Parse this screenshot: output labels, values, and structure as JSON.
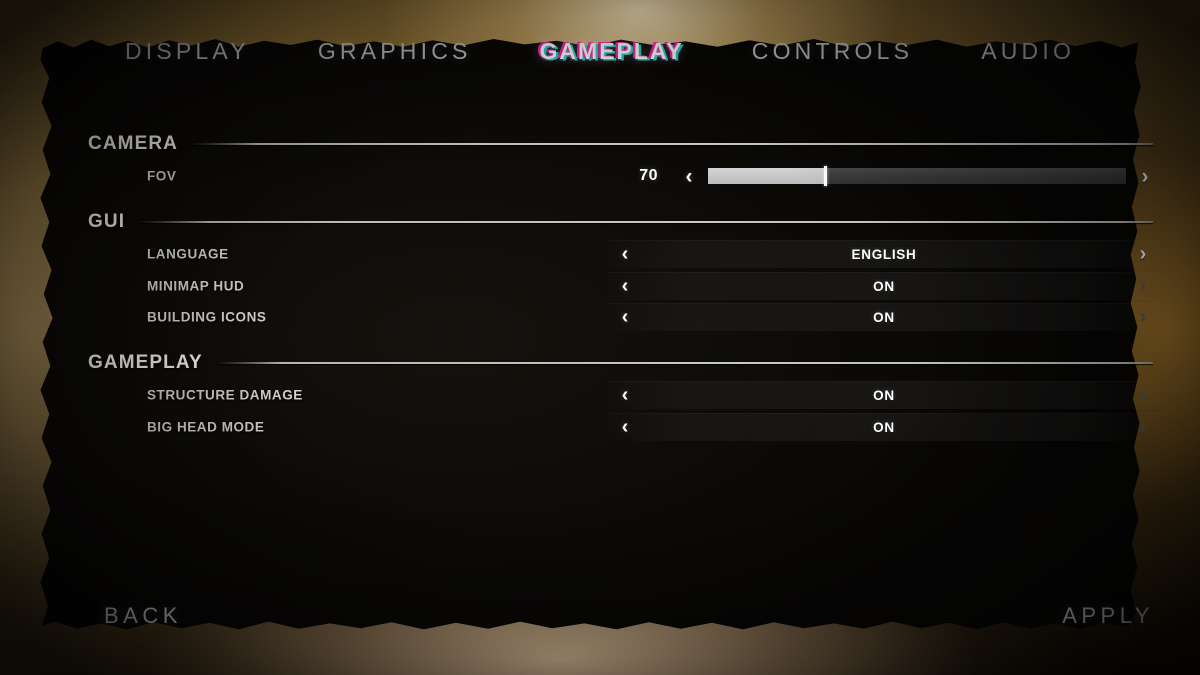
{
  "menu": {
    "tabs": [
      {
        "label": "DISPLAY",
        "active": false
      },
      {
        "label": "GRAPHICS",
        "active": false
      },
      {
        "label": "GAMEPLAY",
        "active": true
      },
      {
        "label": "CONTROLS",
        "active": false
      },
      {
        "label": "AUDIO",
        "active": false
      }
    ],
    "sections": [
      {
        "title": "CAMERA",
        "options": [
          {
            "label": "FOV",
            "type": "slider",
            "value": "70",
            "fill_percent": 28,
            "left_arrow": "‹",
            "right_arrow": "›",
            "left_enabled": true,
            "right_enabled": true
          }
        ]
      },
      {
        "title": "GUI",
        "options": [
          {
            "label": "LANGUAGE",
            "type": "selector",
            "value": "ENGLISH",
            "left_arrow": "‹",
            "right_arrow": "›",
            "left_enabled": true,
            "right_enabled": true
          },
          {
            "label": "MINIMAP HUD",
            "type": "selector",
            "value": "ON",
            "left_arrow": "‹",
            "right_arrow": "›",
            "left_enabled": true,
            "right_enabled": false
          },
          {
            "label": "BUILDING ICONS",
            "type": "selector",
            "value": "ON",
            "left_arrow": "‹",
            "right_arrow": "›",
            "left_enabled": true,
            "right_enabled": false
          }
        ]
      },
      {
        "title": "GAMEPLAY",
        "options": [
          {
            "label": "STRUCTURE DAMAGE",
            "type": "selector",
            "value": "ON",
            "left_arrow": "‹",
            "right_arrow": "›",
            "left_enabled": true,
            "right_enabled": false
          },
          {
            "label": "BIG HEAD MODE",
            "type": "selector",
            "value": "ON",
            "left_arrow": "‹",
            "right_arrow": "›",
            "left_enabled": true,
            "right_enabled": false
          }
        ]
      }
    ],
    "footer": {
      "back_label": "BACK",
      "apply_label": "APPLY"
    },
    "colors": {
      "panel": "#0b0907",
      "backdrop_warm": "#8a6c33",
      "text_primary": "#ffffff",
      "text_label": "#d6d3cd",
      "text_muted": "#5a5a58",
      "rule": "#d4d4cf",
      "slider_fill": "#c6c6c6",
      "slider_track": "#3c3c3c",
      "glitch_magenta": "#ff28aa",
      "glitch_cyan": "#28e6dc"
    }
  }
}
